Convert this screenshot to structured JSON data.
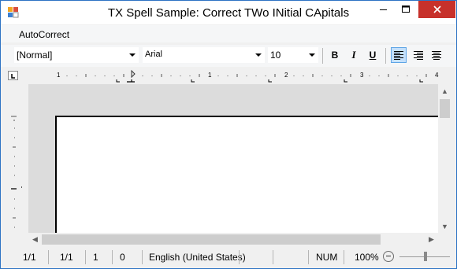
{
  "window": {
    "title": "TX Spell Sample: Correct TWo INitial CApitals"
  },
  "menu": {
    "items": [
      {
        "label": "AutoCorrect"
      }
    ]
  },
  "toolbar": {
    "style_value": "[Normal]",
    "font_value": "Arial",
    "size_value": "10",
    "bold_label": "B",
    "italic_label": "I",
    "underline_label": "U",
    "active_alignment": "left"
  },
  "ruler": {
    "tick_labels": [
      "1",
      "1",
      "2",
      "3",
      "4"
    ]
  },
  "status": {
    "page": "1/1",
    "section": "1/1",
    "line": "1",
    "column": "0",
    "language": "English (United States)",
    "num_lock": "NUM",
    "zoom": "100%",
    "zoom_level": 1.0
  },
  "colors": {
    "close_button": "#c7312b",
    "active_button": "#c4e0fb",
    "document_background": "#dcdcdc"
  }
}
